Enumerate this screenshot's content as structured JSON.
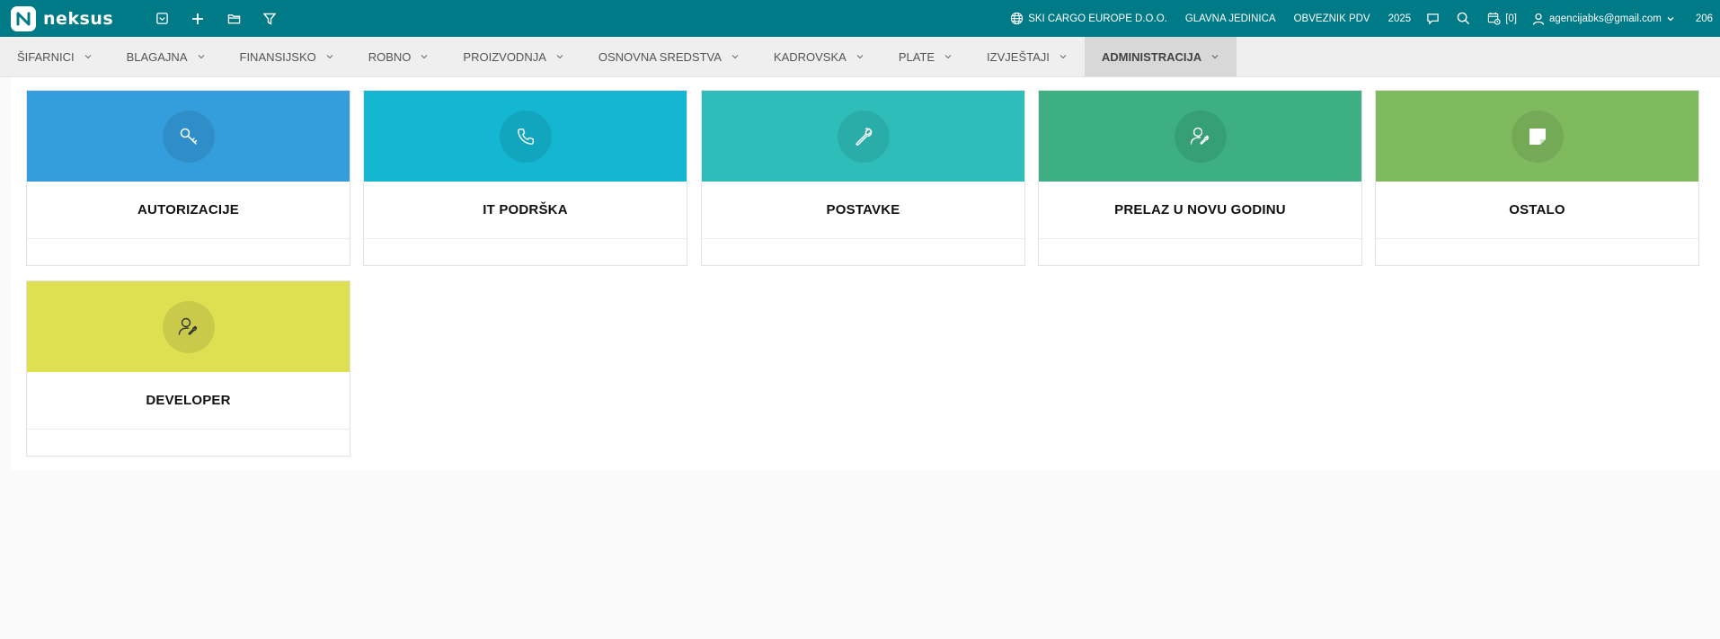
{
  "app": {
    "logo_text": "neksus"
  },
  "topbar": {
    "icons": [
      "inbox-icon",
      "plus-icon",
      "folder-icon",
      "filter-icon"
    ],
    "company": "SKI CARGO EUROPE D.O.O.",
    "unit": "GLAVNA JEDINICA",
    "tax_status": "OBVEZNIK PDV",
    "year": "2025",
    "notifications": "[0]",
    "user_email": "agencijabks@gmail.com",
    "extra_number": "206"
  },
  "nav": {
    "items": [
      "ŠIFARNICI",
      "BLAGAJNA",
      "FINANSIJSKO",
      "ROBNO",
      "PROIZVODNJA",
      "OSNOVNA SREDSTVA",
      "KADROVSKA",
      "PLATE",
      "IZVJEŠTAJI",
      "ADMINISTRACIJA"
    ],
    "active": "ADMINISTRACIJA"
  },
  "cards": [
    {
      "title": "AUTORIZACIJE",
      "icon": "key-icon",
      "color": "#349ddc"
    },
    {
      "title": "IT PODRŠKA",
      "icon": "phone-icon",
      "color": "#14b6d1"
    },
    {
      "title": "POSTAVKE",
      "icon": "wrench-icon",
      "color": "#2fbdba"
    },
    {
      "title": "PRELAZ U NOVU GODINU",
      "icon": "user-wrench-icon",
      "color": "#3daf82"
    },
    {
      "title": "OSTALO",
      "icon": "note-icon",
      "color": "#80ba5f"
    },
    {
      "title": "DEVELOPER",
      "icon": "user-wrench-icon",
      "color": "#dfdf52"
    }
  ],
  "colors": {
    "topbar": "#007a86",
    "nav_bg": "#efefef",
    "nav_active": "#d8d8d8"
  }
}
